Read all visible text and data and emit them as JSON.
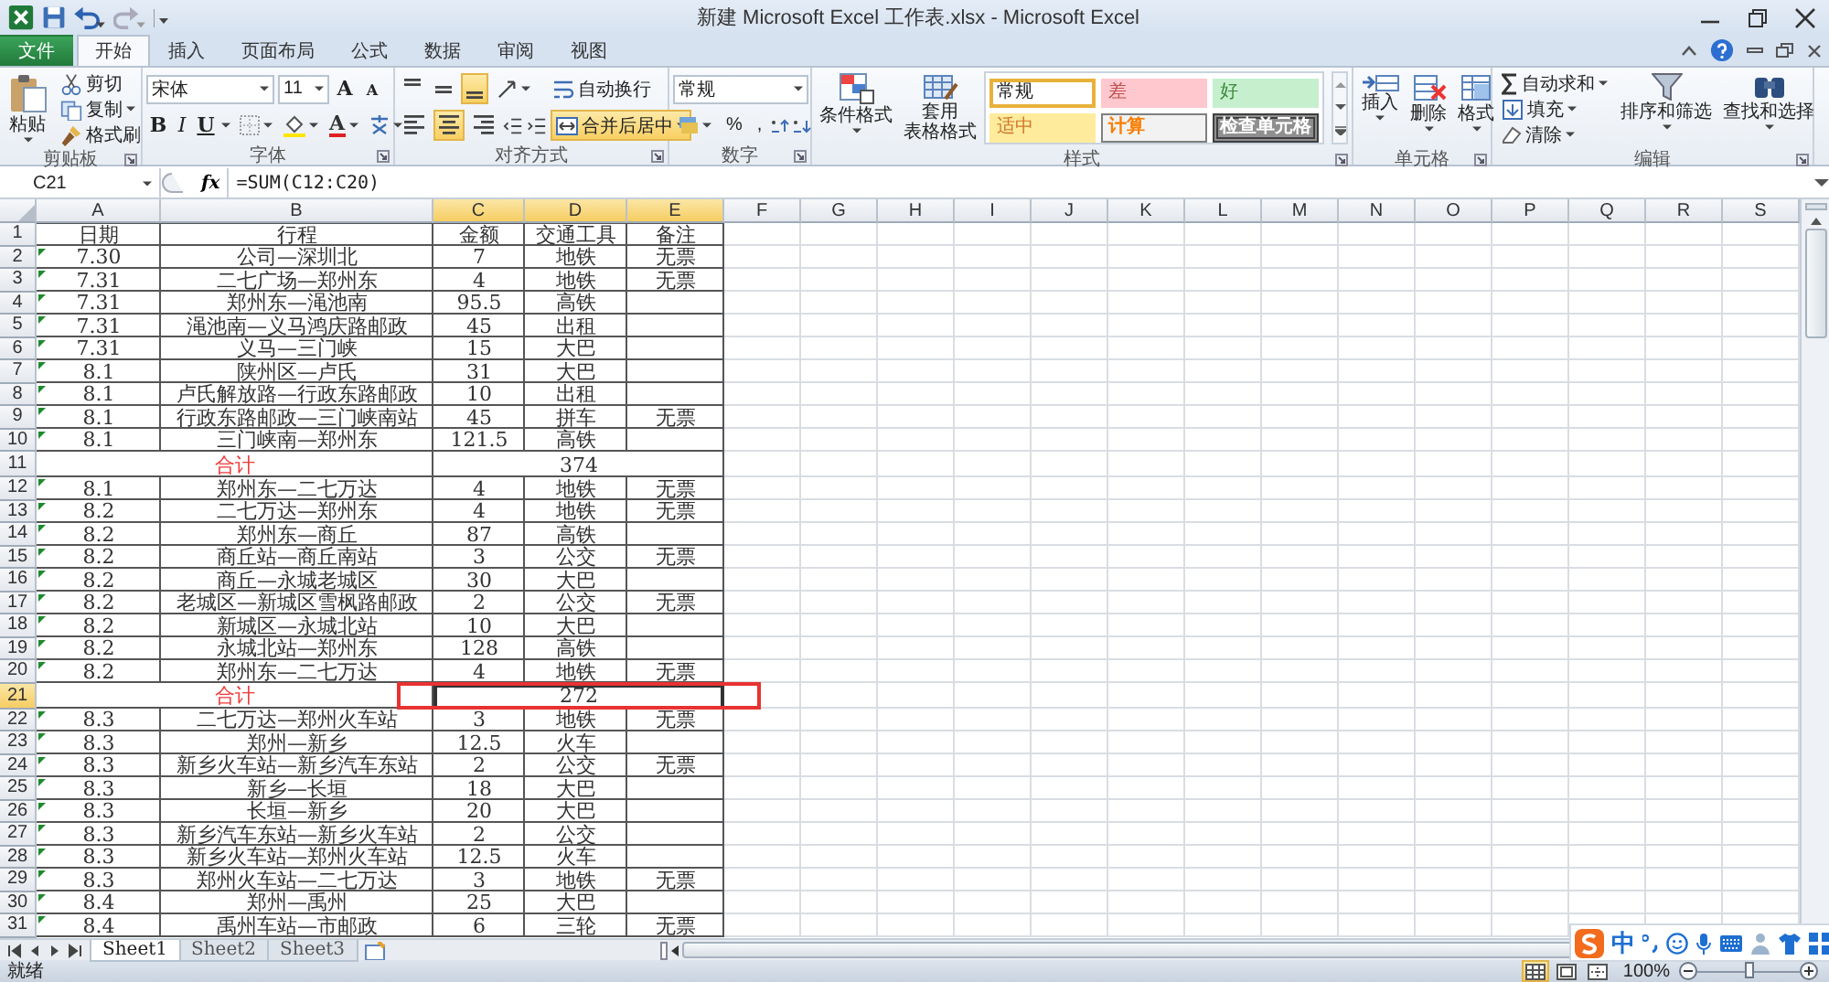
{
  "title_bar": {
    "title": "新建 Microsoft Excel 工作表.xlsx - Microsoft Excel"
  },
  "ribbon_tabs": [
    {
      "label": "文件",
      "kind": "file",
      "selected": false
    },
    {
      "label": "开始",
      "kind": "tab",
      "selected": true
    },
    {
      "label": "插入",
      "kind": "tab",
      "selected": false
    },
    {
      "label": "页面布局",
      "kind": "tab",
      "selected": false
    },
    {
      "label": "公式",
      "kind": "tab",
      "selected": false
    },
    {
      "label": "数据",
      "kind": "tab",
      "selected": false
    },
    {
      "label": "审阅",
      "kind": "tab",
      "selected": false
    },
    {
      "label": "视图",
      "kind": "tab",
      "selected": false
    }
  ],
  "clipboard": {
    "paste": "粘贴",
    "items": [
      {
        "label": "剪切",
        "kind": "cut"
      },
      {
        "label": "复制",
        "kind": "copy"
      },
      {
        "label": "格式刷",
        "kind": "brush"
      }
    ],
    "label": "剪贴板"
  },
  "font": {
    "name": "宋体",
    "size": "11",
    "grow": "A",
    "shrink": "A",
    "bold": "B",
    "italic": "I",
    "underline": "U",
    "font_color": "A",
    "label": "字体"
  },
  "alignment": {
    "vertical": [
      {
        "kind": "top",
        "selected": false
      },
      {
        "kind": "middle",
        "selected": false
      },
      {
        "kind": "bottom",
        "selected": true
      }
    ],
    "horizontal": [
      {
        "kind": "left",
        "selected": false
      },
      {
        "kind": "center",
        "selected": true
      },
      {
        "kind": "right",
        "selected": false
      }
    ],
    "wrap_text": "自动换行",
    "merge": {
      "label": "合并后居中",
      "selected": true
    },
    "label": "对齐方式"
  },
  "number": {
    "format": "常规",
    "percent": "%",
    "comma": ",",
    "label": "数字"
  },
  "styles": {
    "conditional": "条件格式",
    "table_format": [
      "套用",
      "表格格式"
    ],
    "cell_styles": [
      {
        "label": "常规",
        "kind": "normal",
        "selected": true
      },
      {
        "label": "差",
        "kind": "bad",
        "selected": false
      },
      {
        "label": "好",
        "kind": "good",
        "selected": false
      },
      {
        "label": "适中",
        "kind": "neutral",
        "selected": false
      },
      {
        "label": "计算",
        "kind": "calculation",
        "selected": false
      },
      {
        "label": "检查单元格",
        "kind": "check",
        "selected": false
      }
    ],
    "label": "样式"
  },
  "cells": {
    "buttons": [
      {
        "label": "插入",
        "kind": "insert"
      },
      {
        "label": "删除",
        "kind": "delete"
      },
      {
        "label": "格式",
        "kind": "format"
      }
    ],
    "label": "单元格"
  },
  "editing": {
    "items": [
      {
        "label": "自动求和",
        "kind": "sum"
      },
      {
        "label": "填充",
        "kind": "fill"
      },
      {
        "label": "清除",
        "kind": "clear"
      }
    ],
    "buttons": [
      {
        "label": "排序和筛选",
        "kind": "sort"
      },
      {
        "label": "查找和选择",
        "kind": "find"
      }
    ],
    "label": "编辑"
  },
  "formula_bar": {
    "name_box": "C21",
    "function_button": "fx",
    "formula": "=SUM(C12:C20)"
  },
  "columns": [
    {
      "label": "A",
      "selected": false
    },
    {
      "label": "B",
      "selected": false
    },
    {
      "label": "C",
      "selected": true
    },
    {
      "label": "D",
      "selected": true
    },
    {
      "label": "E",
      "selected": true
    },
    {
      "label": "F",
      "selected": false
    },
    {
      "label": "G",
      "selected": false
    },
    {
      "label": "H",
      "selected": false
    },
    {
      "label": "I",
      "selected": false
    },
    {
      "label": "J",
      "selected": false
    },
    {
      "label": "K",
      "selected": false
    },
    {
      "label": "L",
      "selected": false
    },
    {
      "label": "M",
      "selected": false
    },
    {
      "label": "N",
      "selected": false
    },
    {
      "label": "O",
      "selected": false
    },
    {
      "label": "P",
      "selected": false
    },
    {
      "label": "Q",
      "selected": false
    },
    {
      "label": "R",
      "selected": false
    },
    {
      "label": "S",
      "selected": false
    }
  ],
  "rows": [
    {
      "num": "1",
      "kind": "header",
      "selected": false,
      "date": "日期",
      "route": "行程",
      "amount": "金额",
      "transport": "交通工具",
      "note": "备注"
    },
    {
      "num": "2",
      "kind": "data",
      "selected": false,
      "date": "7.30",
      "route": "公司—深圳北",
      "amount": "7",
      "transport": "地铁",
      "note": "无票"
    },
    {
      "num": "3",
      "kind": "data",
      "selected": false,
      "date": "7.31",
      "route": "二七广场—郑州东",
      "amount": "4",
      "transport": "地铁",
      "note": "无票"
    },
    {
      "num": "4",
      "kind": "data",
      "selected": false,
      "date": "7.31",
      "route": "郑州东—渑池南",
      "amount": "95.5",
      "transport": "高铁"
    },
    {
      "num": "5",
      "kind": "data",
      "selected": false,
      "date": "7.31",
      "route": "渑池南—义马鸿庆路邮政",
      "amount": "45",
      "transport": "出租"
    },
    {
      "num": "6",
      "kind": "data",
      "selected": false,
      "date": "7.31",
      "route": "义马—三门峡",
      "amount": "15",
      "transport": "大巴"
    },
    {
      "num": "7",
      "kind": "data",
      "selected": false,
      "date": "8.1",
      "route": "陕州区—卢氏",
      "amount": "31",
      "transport": "大巴"
    },
    {
      "num": "8",
      "kind": "data",
      "selected": false,
      "date": "8.1",
      "route": "卢氏解放路—行政东路邮政",
      "amount": "10",
      "transport": "出租"
    },
    {
      "num": "9",
      "kind": "data",
      "selected": false,
      "date": "8.1",
      "route": "行政东路邮政—三门峡南站",
      "amount": "45",
      "transport": "拼车",
      "note": "无票"
    },
    {
      "num": "10",
      "kind": "data",
      "selected": false,
      "date": "8.1",
      "route": "三门峡南—郑州东",
      "amount": "121.5",
      "transport": "高铁"
    },
    {
      "num": "11",
      "kind": "total",
      "selected": false,
      "label": "合计",
      "value": "374"
    },
    {
      "num": "12",
      "kind": "data",
      "selected": false,
      "date": "8.1",
      "route": "郑州东—二七万达",
      "amount": "4",
      "transport": "地铁",
      "note": "无票"
    },
    {
      "num": "13",
      "kind": "data",
      "selected": false,
      "date": "8.2",
      "route": "二七万达—郑州东",
      "amount": "4",
      "transport": "地铁",
      "note": "无票"
    },
    {
      "num": "14",
      "kind": "data",
      "selected": false,
      "date": "8.2",
      "route": "郑州东—商丘",
      "amount": "87",
      "transport": "高铁"
    },
    {
      "num": "15",
      "kind": "data",
      "selected": false,
      "date": "8.2",
      "route": "商丘站—商丘南站",
      "amount": "3",
      "transport": "公交",
      "note": "无票"
    },
    {
      "num": "16",
      "kind": "data",
      "selected": false,
      "date": "8.2",
      "route": "商丘—永城老城区",
      "amount": "30",
      "transport": "大巴"
    },
    {
      "num": "17",
      "kind": "data",
      "selected": false,
      "date": "8.2",
      "route": "老城区—新城区雪枫路邮政",
      "amount": "2",
      "transport": "公交",
      "note": "无票"
    },
    {
      "num": "18",
      "kind": "data",
      "selected": false,
      "date": "8.2",
      "route": "新城区—永城北站",
      "amount": "10",
      "transport": "大巴"
    },
    {
      "num": "19",
      "kind": "data",
      "selected": false,
      "date": "8.2",
      "route": "永城北站—郑州东",
      "amount": "128",
      "transport": "高铁"
    },
    {
      "num": "20",
      "kind": "data",
      "selected": false,
      "date": "8.2",
      "route": "郑州东—二七万达",
      "amount": "4",
      "transport": "地铁",
      "note": "无票"
    },
    {
      "num": "21",
      "kind": "total",
      "selected": true,
      "label": "合计",
      "value": "272"
    },
    {
      "num": "22",
      "kind": "data",
      "selected": false,
      "date": "8.3",
      "route": "二七万达—郑州火车站",
      "amount": "3",
      "transport": "地铁",
      "note": "无票"
    },
    {
      "num": "23",
      "kind": "data",
      "selected": false,
      "date": "8.3",
      "route": "郑州—新乡",
      "amount": "12.5",
      "transport": "火车"
    },
    {
      "num": "24",
      "kind": "data",
      "selected": false,
      "date": "8.3",
      "route": "新乡火车站—新乡汽车东站",
      "amount": "2",
      "transport": "公交",
      "note": "无票"
    },
    {
      "num": "25",
      "kind": "data",
      "selected": false,
      "date": "8.3",
      "route": "新乡—长垣",
      "amount": "18",
      "transport": "大巴"
    },
    {
      "num": "26",
      "kind": "data",
      "selected": false,
      "date": "8.3",
      "route": "长垣—新乡",
      "amount": "20",
      "transport": "大巴"
    },
    {
      "num": "27",
      "kind": "data",
      "selected": false,
      "date": "8.3",
      "route": "新乡汽车东站—新乡火车站",
      "amount": "2",
      "transport": "公交"
    },
    {
      "num": "28",
      "kind": "data",
      "selected": false,
      "date": "8.3",
      "route": "新乡火车站—郑州火车站",
      "amount": "12.5",
      "transport": "火车"
    },
    {
      "num": "29",
      "kind": "data",
      "selected": false,
      "date": "8.3",
      "route": "郑州火车站—二七万达",
      "amount": "3",
      "transport": "地铁",
      "note": "无票"
    },
    {
      "num": "30",
      "kind": "data",
      "selected": false,
      "date": "8.4",
      "route": "郑州—禹州",
      "amount": "25",
      "transport": "大巴"
    },
    {
      "num": "31",
      "kind": "data",
      "selected": false,
      "date": "8.4",
      "route": "禹州车站—市邮政",
      "amount": "6",
      "transport": "三轮",
      "note": "无票"
    }
  ],
  "annotation": {
    "kind": "rectangle"
  },
  "sheet_tabs": [
    {
      "label": "Sheet1",
      "selected": true
    },
    {
      "label": "Sheet2",
      "selected": false
    },
    {
      "label": "Sheet3",
      "selected": false
    }
  ],
  "status_bar": {
    "status": "就绪",
    "views": [
      {
        "kind": "normal",
        "selected": true
      },
      {
        "kind": "page_layout",
        "selected": false
      },
      {
        "kind": "page_break",
        "selected": false
      }
    ],
    "zoom": "100%",
    "zoom_slider": {
      "level": 0.5
    }
  },
  "ime_bar": {
    "mode": "中"
  }
}
